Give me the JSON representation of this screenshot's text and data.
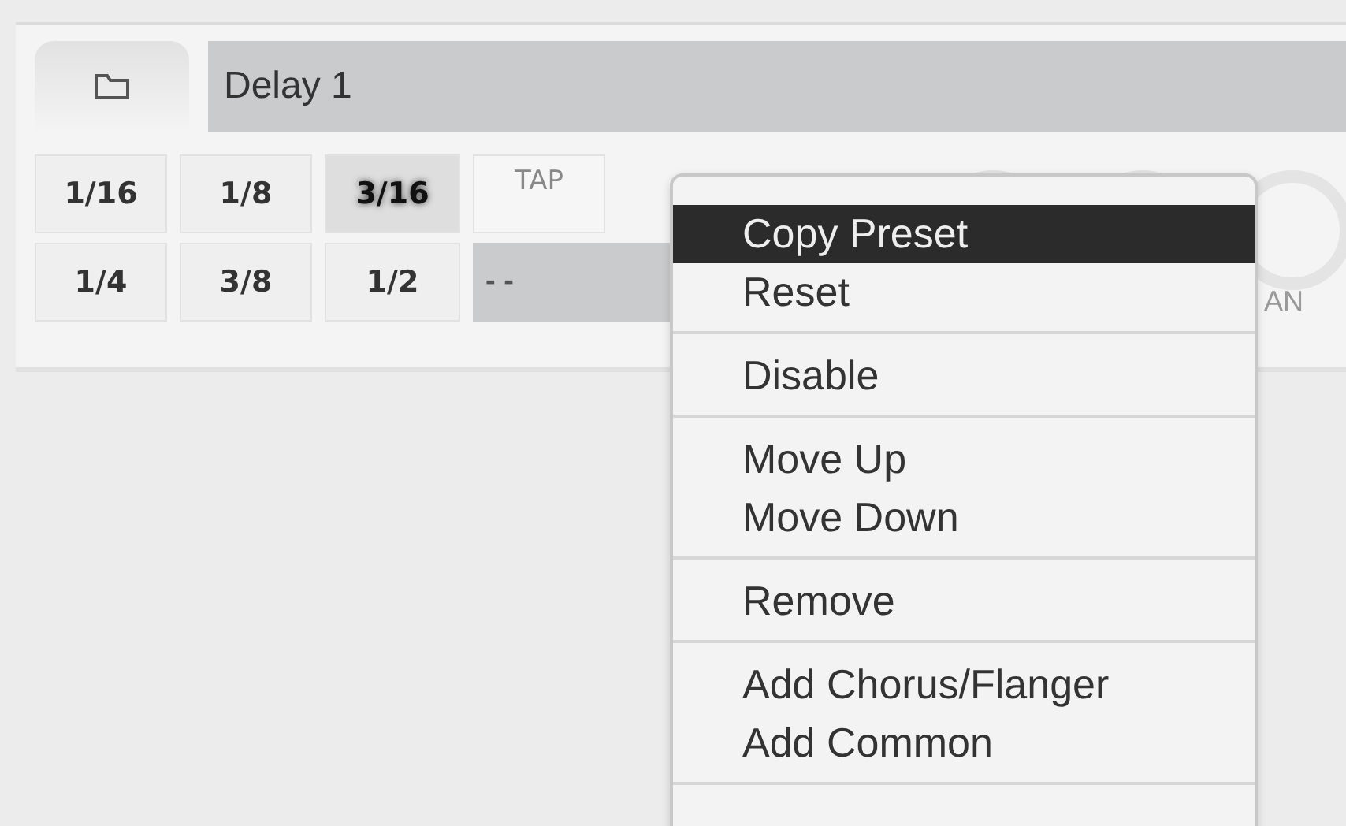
{
  "preset": {
    "title": "Delay 1"
  },
  "divisions": [
    {
      "label": "1/16",
      "selected": false,
      "kind": "note"
    },
    {
      "label": "1/8",
      "selected": false,
      "kind": "note"
    },
    {
      "label": "3/16",
      "selected": true,
      "kind": "note"
    },
    {
      "label": "TAP",
      "selected": false,
      "kind": "tap"
    },
    {
      "label": "1/4",
      "selected": false,
      "kind": "note"
    },
    {
      "label": "3/8",
      "selected": false,
      "kind": "note"
    },
    {
      "label": "1/2",
      "selected": false,
      "kind": "note"
    },
    {
      "label": "- -",
      "kind": "readout"
    }
  ],
  "knob_label": "AN",
  "context_menu": [
    [
      {
        "label": "Copy Preset",
        "selected": true
      },
      {
        "label": "Reset",
        "selected": false
      }
    ],
    [
      {
        "label": "Disable",
        "selected": false
      }
    ],
    [
      {
        "label": "Move Up",
        "selected": false
      },
      {
        "label": "Move Down",
        "selected": false
      }
    ],
    [
      {
        "label": "Remove",
        "selected": false
      }
    ],
    [
      {
        "label": "Add Chorus/Flanger",
        "selected": false
      },
      {
        "label": "Add Common",
        "selected": false
      }
    ]
  ]
}
